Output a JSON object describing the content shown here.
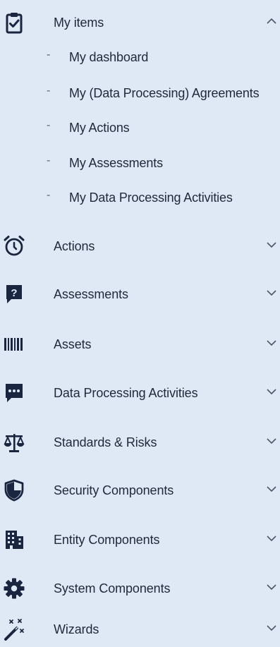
{
  "menu": {
    "my_items": {
      "label": "My items",
      "icon": "clipboard-check-icon",
      "expanded": true,
      "children": [
        {
          "label": "My dashboard"
        },
        {
          "label": "My (Data Processing) Agreements"
        },
        {
          "label": "My Actions"
        },
        {
          "label": "My Assessments"
        },
        {
          "label": "My Data Processing Activities"
        }
      ]
    },
    "items": [
      {
        "label": "Actions",
        "icon": "alarm-clock-icon"
      },
      {
        "label": "Assessments",
        "icon": "question-mark-chat-icon"
      },
      {
        "label": "Assets",
        "icon": "barcode-icon"
      },
      {
        "label": "Data Processing Activities",
        "icon": "chat-dots-icon"
      },
      {
        "label": "Standards & Risks",
        "icon": "scales-icon"
      },
      {
        "label": "Security Components",
        "icon": "shield-icon"
      },
      {
        "label": "Entity Components",
        "icon": "building-icon"
      },
      {
        "label": "System Components",
        "icon": "gear-icon"
      },
      {
        "label": "Wizards",
        "icon": "magic-wand-icon"
      }
    ]
  },
  "colors": {
    "background": "#dfe8f5",
    "text": "#1e2a3a",
    "icon": "#1a2540"
  }
}
